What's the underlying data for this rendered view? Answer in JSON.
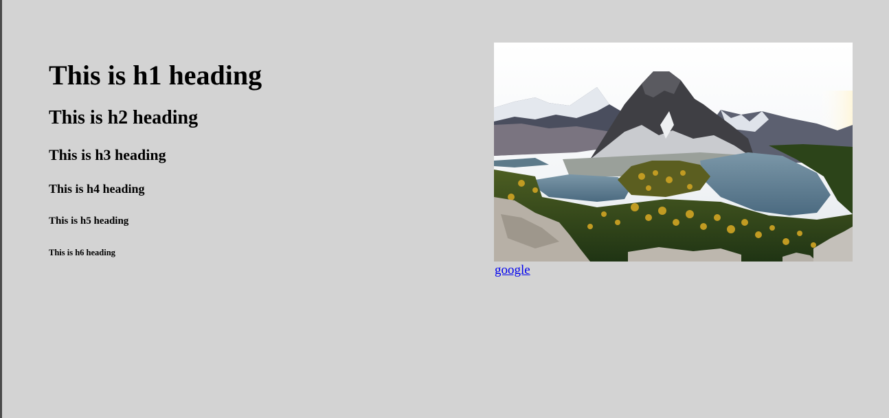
{
  "headings": {
    "h1": "This is h1 heading",
    "h2": "This is h2 heading",
    "h3": "This is h3 heading",
    "h4": "This is h4 heading",
    "h5": "This is h5 heading",
    "h6": "This is h6 heading"
  },
  "image": {
    "icon": "mountain-lake-landscape-image",
    "colors": {
      "sky": "#ffffff",
      "mountain": "#4a4a4f",
      "snow": "#e9ecef",
      "lake": "#5f7f94",
      "forest": "#2f4a20",
      "larch": "#b8951e",
      "rock": "#b7b0a6"
    }
  },
  "link": {
    "label": "google"
  }
}
